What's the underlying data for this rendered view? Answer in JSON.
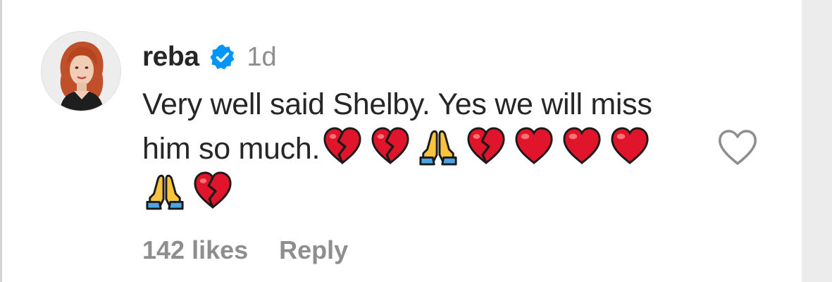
{
  "comment": {
    "username": "reba",
    "verified": true,
    "timestamp": "1d",
    "text": "Very well said Shelby. Yes we will miss him so much.",
    "emojis": [
      "broken-heart",
      "broken-heart",
      "folded-hands",
      "broken-heart",
      "red-heart",
      "red-heart",
      "red-heart",
      "folded-hands",
      "broken-heart"
    ],
    "likes_label": "142 likes",
    "reply_label": "Reply",
    "liked": false
  },
  "colors": {
    "text": "#262626",
    "muted": "#8e8e8e",
    "verified": "#0095f6",
    "heart": "#e0142b"
  },
  "icons": {
    "verified": "verified-badge-icon",
    "like": "heart-outline-icon",
    "avatar": "user-avatar"
  }
}
